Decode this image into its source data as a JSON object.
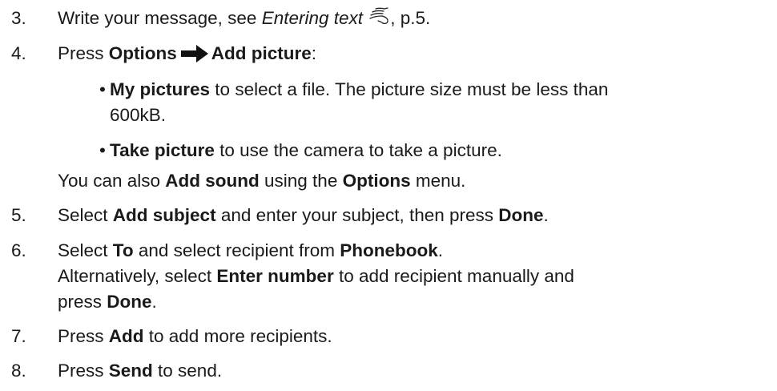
{
  "steps": [
    {
      "num": "3.",
      "a": "Write your message, see ",
      "italic": "Entering text",
      "b": ", p.5."
    },
    {
      "num": "4.",
      "press": "Press ",
      "options": "Options",
      "add_picture": "Add picture",
      "colon": ":"
    },
    {
      "num": "5.",
      "a": "Select ",
      "b1": "Add subject",
      "c": " and enter your subject, then press ",
      "b2": "Done",
      "d": "."
    },
    {
      "num": "6.",
      "a": "Select ",
      "b1": "To",
      "c": " and select recipient from ",
      "b2": "Phonebook",
      "d": ".",
      "l2a": "Alternatively, select ",
      "l2b": "Enter number",
      "l2c": " to add recipient manually and",
      "l3a": "press ",
      "l3b": "Done",
      "l3c": "."
    },
    {
      "num": "7.",
      "a": "Press ",
      "b1": "Add",
      "c": " to add more recipients."
    },
    {
      "num": "8.",
      "a": "Press ",
      "b1": "Send",
      "c": " to send."
    }
  ],
  "bullets": [
    {
      "symbol": "•",
      "bold": "My pictures",
      "rest": " to select a file. The picture size must be less than",
      "cont": "600kB."
    },
    {
      "symbol": "•",
      "bold": "Take picture",
      "rest": " to use the camera to take a picture."
    }
  ],
  "note": {
    "a": "You can also ",
    "b1": "Add sound",
    "c": " using the ",
    "b2": "Options",
    "d": " menu."
  },
  "icons": {
    "hand": "hand-pointing-icon",
    "arrow": "right-arrow-icon"
  }
}
